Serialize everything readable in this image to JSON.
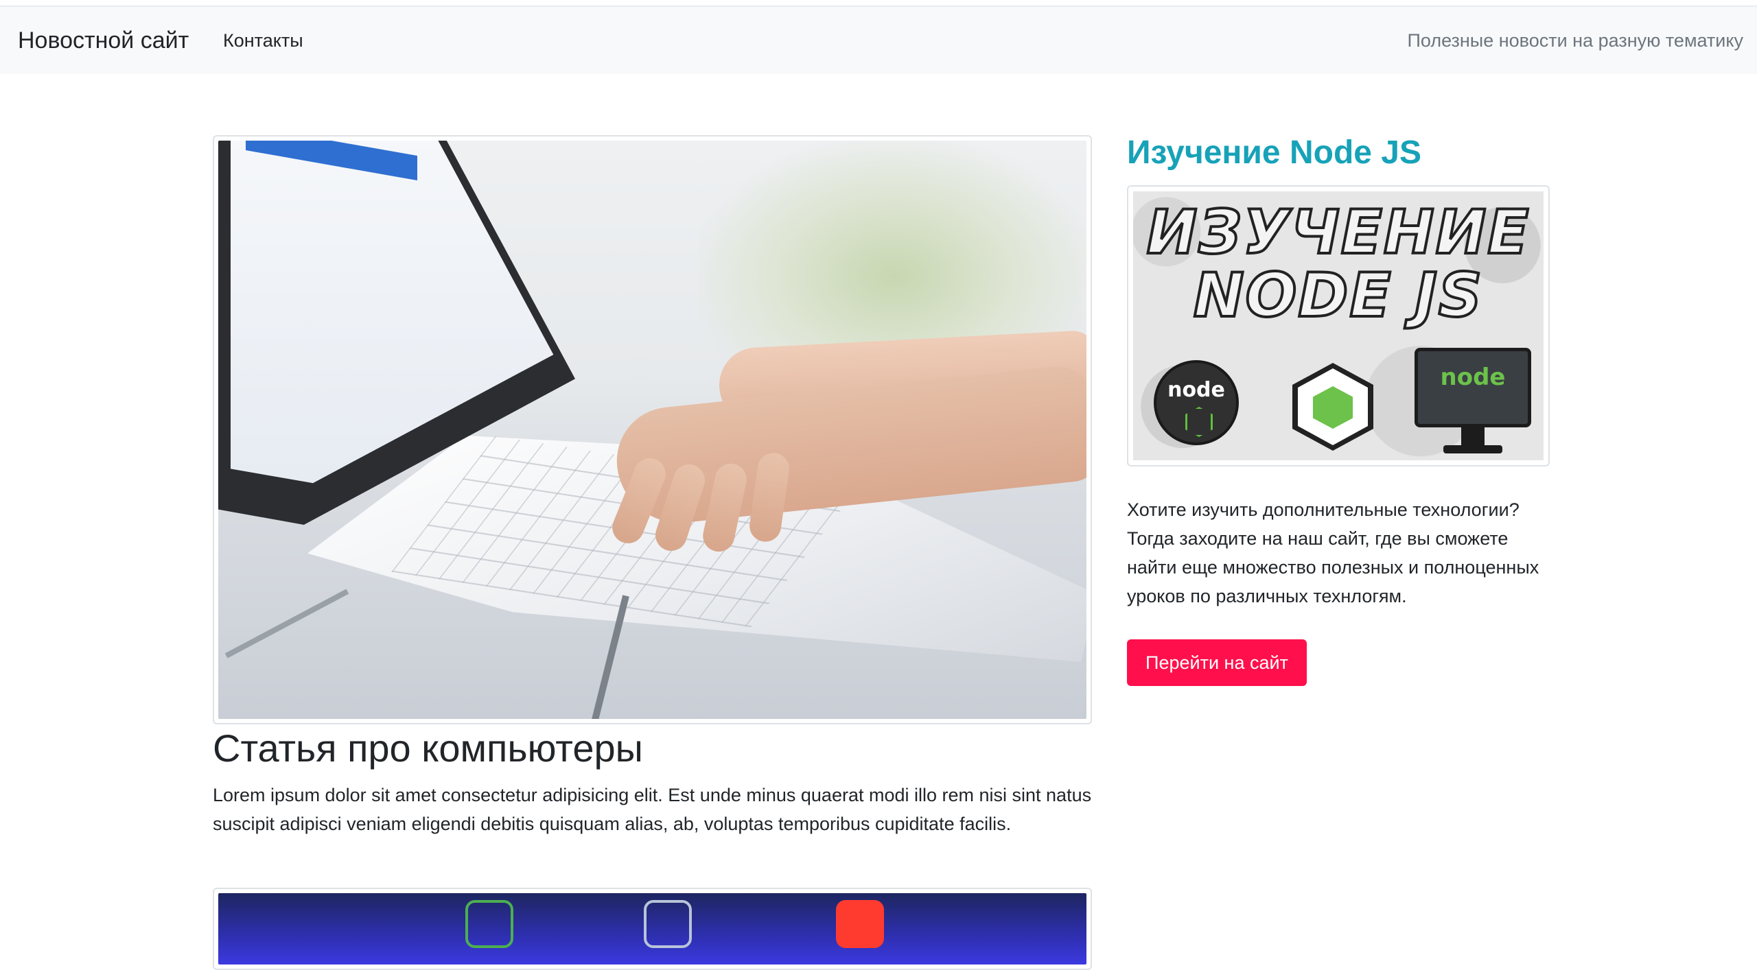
{
  "navbar": {
    "brand": "Новостной сайт",
    "contacts_link": "Контакты",
    "tagline": "Полезные новости на разную тематику"
  },
  "article": {
    "title": "Статья про компьютеры",
    "text": "Lorem ipsum dolor sit amet consectetur adipisicing elit. Est unde minus quaerat modi illo rem nisi sint natus suscipit adipisci veniam eligendi debitis quisquam alias, ab, voluptas temporibus cupiditate facilis."
  },
  "sidebar": {
    "title": "Изучение Node JS",
    "banner_text": "ИЗУЧЕНИЕ NODE JS",
    "banner_logo_text": "node",
    "banner_monitor_text": "node",
    "text": "Хотите изучить дополнительные технологии? Тогда заходите на наш сайт, где вы сможете найти еще множество полезных и полноценных уроков по различных технлогям.",
    "button_label": "Перейти на сайт"
  },
  "colors": {
    "accent_title": "#17a2b8",
    "button_bg": "#ff0f4b",
    "navbar_bg": "#f8f9fa"
  }
}
